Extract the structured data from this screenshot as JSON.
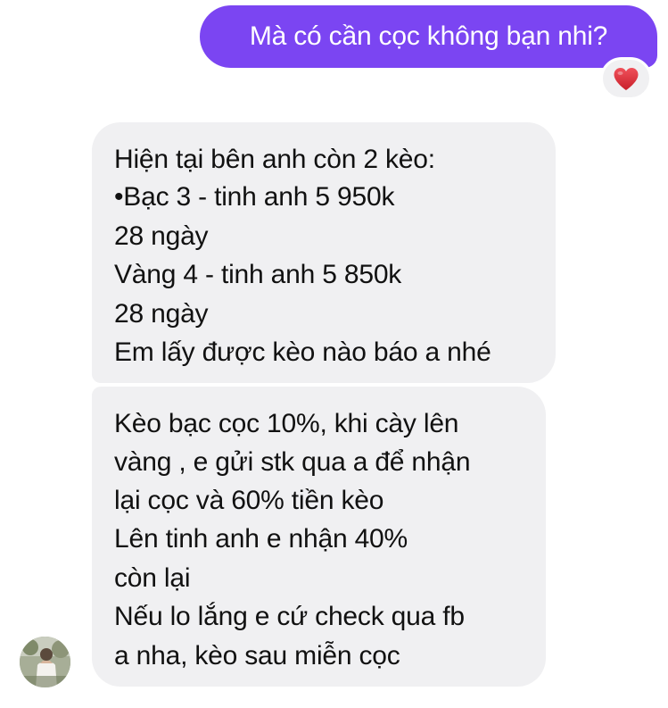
{
  "sent_message": {
    "text": "Mà có cần cọc không bạn nhi?",
    "reaction": "heart-reaction"
  },
  "received_messages": [
    {
      "lines": [
        "Hiện tại bên anh còn 2 kèo:",
        "•Bạc 3 - tinh anh 5  950k",
        "28 ngày",
        "Vàng 4 - tinh anh 5  850k",
        "28 ngày",
        "Em lấy được kèo nào báo a nhé"
      ]
    },
    {
      "lines": [
        "Kèo bạc cọc 10%, khi cày lên",
        "vàng , e gửi stk qua a để nhận",
        "lại cọc và 60% tiền kèo",
        "Lên tinh anh e nhận 40%",
        "còn lại",
        "Nếu lo lắng e cứ check qua fb",
        "a nha, kèo sau miễn cọc"
      ]
    }
  ],
  "colors": {
    "sent_bubble": "#7b45f2",
    "received_bubble": "#f0f0f2",
    "reaction_heart": "#e0323a"
  },
  "icons": {
    "reaction": "heart-icon",
    "sender_avatar": "avatar"
  }
}
